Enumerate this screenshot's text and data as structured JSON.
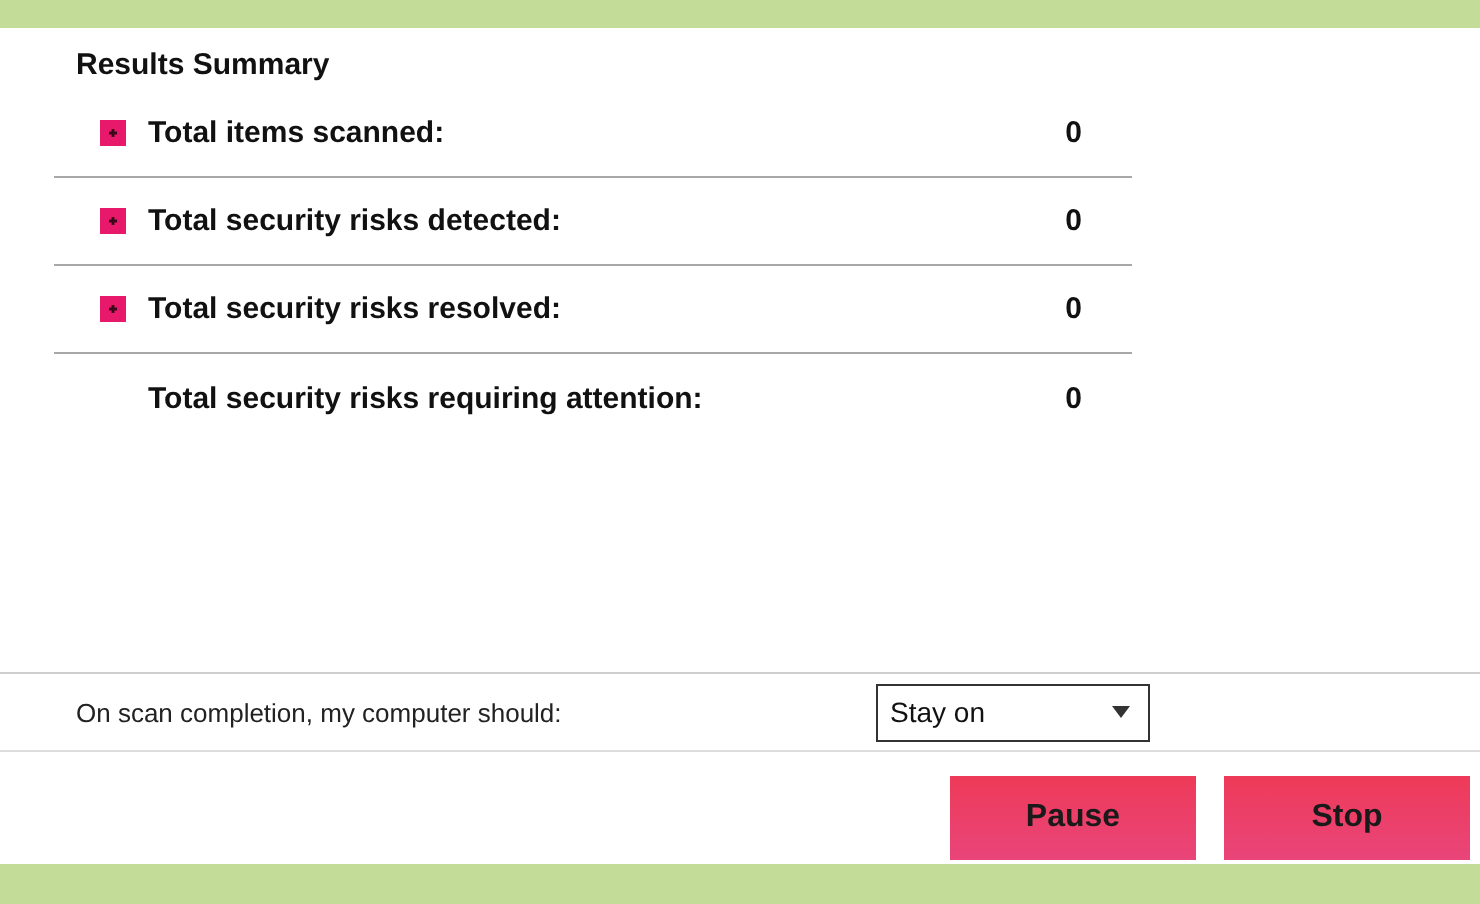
{
  "title": "Results Summary",
  "rows": [
    {
      "label": "Total items scanned:",
      "value": "0",
      "expandable": true
    },
    {
      "label": "Total security risks detected:",
      "value": "0",
      "expandable": true
    },
    {
      "label": "Total security risks resolved:",
      "value": "0",
      "expandable": true
    },
    {
      "label": "Total security risks requiring attention:",
      "value": "0",
      "expandable": false
    }
  ],
  "completion": {
    "label": "On scan completion, my computer should:",
    "value": "Stay on"
  },
  "buttons": [
    "Pause",
    "Stop"
  ]
}
